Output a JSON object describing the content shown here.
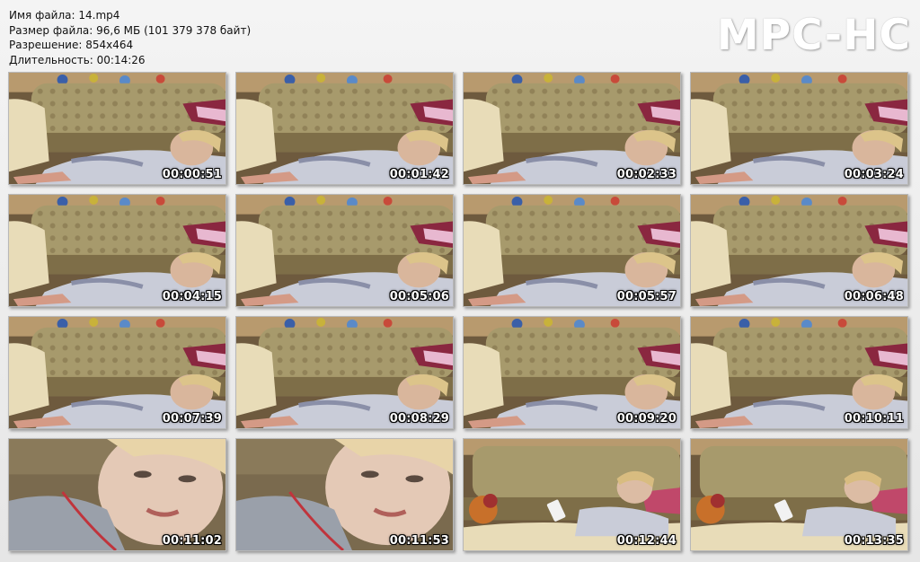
{
  "file_info": {
    "name_line": "Имя файла: 14.mp4",
    "size_line": "Размер файла: 96,6 МБ (101 379 378 байт)",
    "resolution_line": "Разрешение: 854x464",
    "duration_line": "Длительность: 00:14:26"
  },
  "logo": "MPC-HC",
  "thumbnails": [
    {
      "time": "00:00:51",
      "scene": "sofa"
    },
    {
      "time": "00:01:42",
      "scene": "sofa"
    },
    {
      "time": "00:02:33",
      "scene": "sofa"
    },
    {
      "time": "00:03:24",
      "scene": "sofa"
    },
    {
      "time": "00:04:15",
      "scene": "sofa"
    },
    {
      "time": "00:05:06",
      "scene": "sofa"
    },
    {
      "time": "00:05:57",
      "scene": "sofa"
    },
    {
      "time": "00:06:48",
      "scene": "sofa"
    },
    {
      "time": "00:07:39",
      "scene": "sofa"
    },
    {
      "time": "00:08:29",
      "scene": "sofa"
    },
    {
      "time": "00:09:20",
      "scene": "sofa"
    },
    {
      "time": "00:10:11",
      "scene": "sofa"
    },
    {
      "time": "00:11:02",
      "scene": "closeup"
    },
    {
      "time": "00:11:53",
      "scene": "closeup"
    },
    {
      "time": "00:12:44",
      "scene": "phone"
    },
    {
      "time": "00:13:35",
      "scene": "phone"
    }
  ]
}
